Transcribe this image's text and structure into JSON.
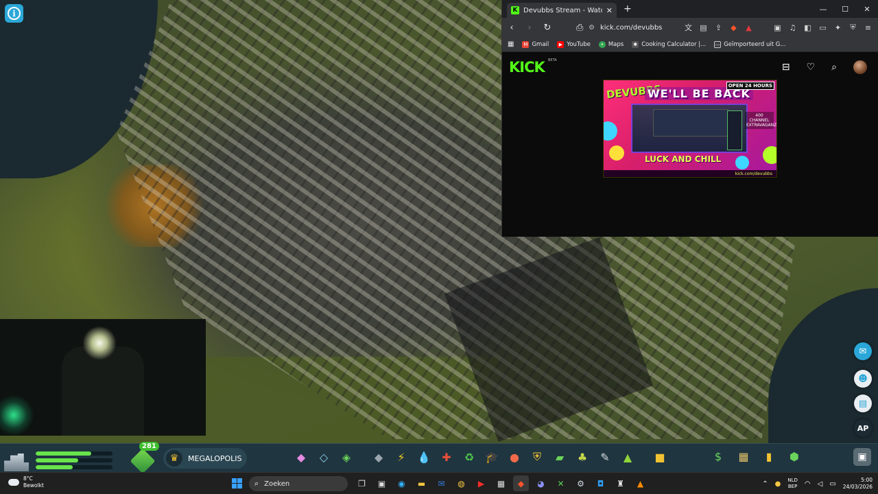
{
  "game": {
    "milestone_label": "MEGALOPOLIS",
    "development_points": "281",
    "bars": [
      0.72,
      0.55,
      0.48
    ],
    "side_buttons": [
      {
        "icon": "speech-bubble-icon"
      },
      {
        "icon": "person-icon"
      },
      {
        "icon": "clipboard-icon"
      },
      {
        "label": "AP"
      }
    ]
  },
  "browser": {
    "tab_title": "Devubbs Stream - Watch Live on Kick",
    "url": "kick.com/devubbs",
    "bookmarks": [
      "Gmail",
      "YouTube",
      "Maps",
      "Cooking Calculator |...",
      "Geïmporteerd uit G..."
    ],
    "kick": {
      "logo": "KICK",
      "beta": "BETA",
      "banner": {
        "brand": "DEVUBBS",
        "title": "WE'LL BE BACK",
        "open": "OPEN 24 HOURS",
        "subtitle": "LUCK AND CHILL",
        "side_text": "400 CHANNEL EXTRAVAGANZA",
        "handle": "kick.com/devubbs"
      }
    }
  },
  "taskbar": {
    "weather_temp": "8°C",
    "weather_desc": "Bewolkt",
    "search_placeholder": "Zoeken",
    "lang_top": "NLD",
    "lang_bottom": "BEP",
    "time": "5:00",
    "date": "24/03/2026"
  },
  "colors": {
    "kick_green": "#53fc18",
    "game_bar": "#1f3540",
    "taskbar": "#202020"
  }
}
